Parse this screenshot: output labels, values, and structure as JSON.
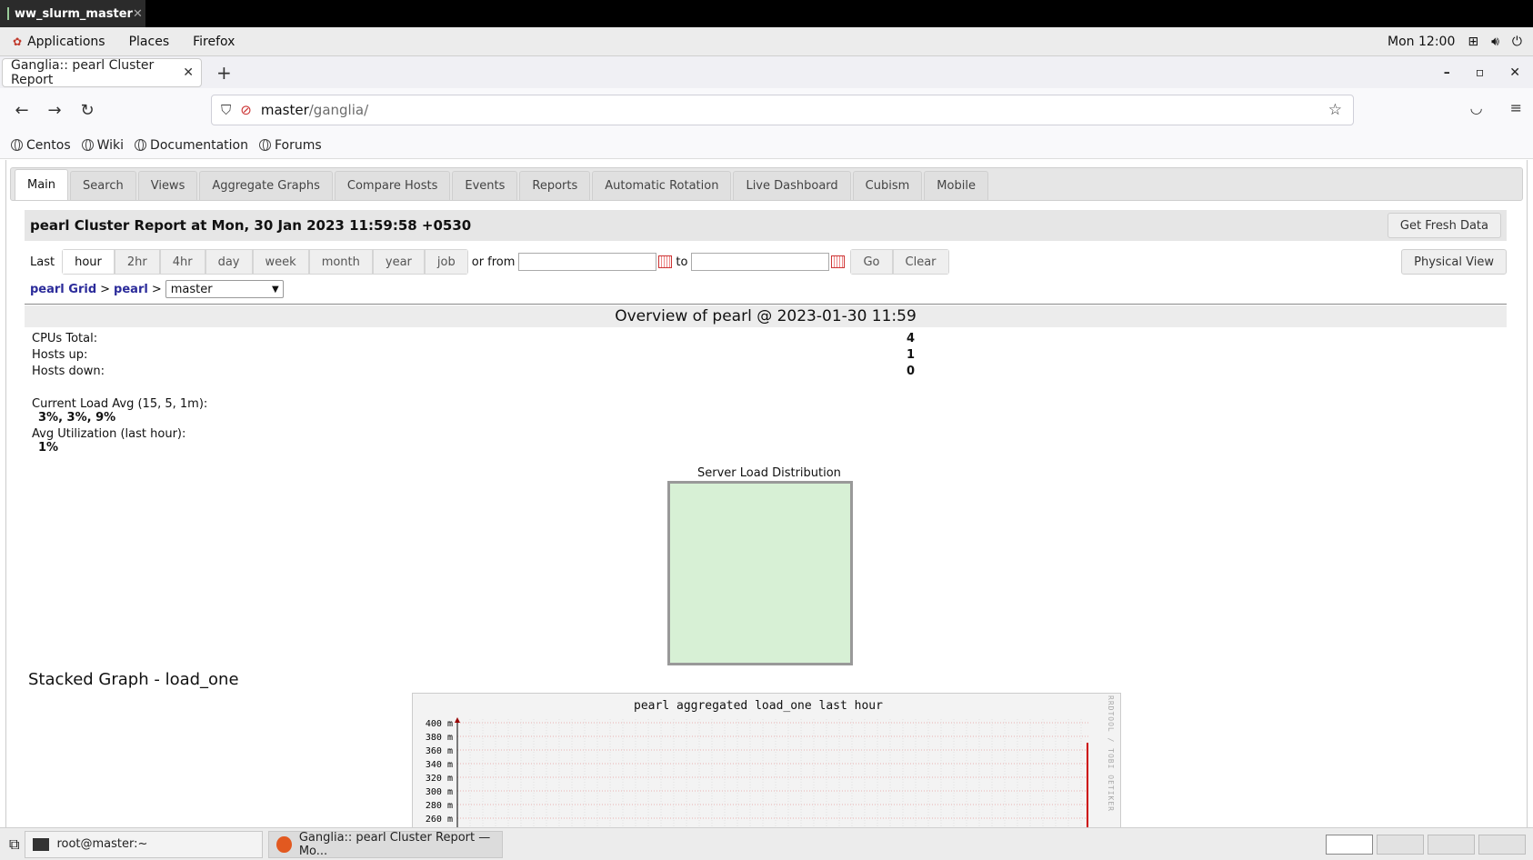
{
  "vnc": {
    "title": "ww_slurm_master"
  },
  "gnome": {
    "menus": [
      "Applications",
      "Places",
      "Firefox"
    ],
    "clock": "Mon 12:00"
  },
  "firefox": {
    "tab_title": "Ganglia:: pearl Cluster Report",
    "url_host": "master",
    "url_path": "/ganglia/",
    "bookmarks": [
      "Centos",
      "Wiki",
      "Documentation",
      "Forums"
    ]
  },
  "ganglia": {
    "tabs": [
      "Main",
      "Search",
      "Views",
      "Aggregate Graphs",
      "Compare Hosts",
      "Events",
      "Reports",
      "Automatic Rotation",
      "Live Dashboard",
      "Cubism",
      "Mobile"
    ],
    "active_tab": "Main",
    "report_title": "pearl Cluster Report at Mon, 30 Jan 2023 11:59:58 +0530",
    "fresh_button": "Get Fresh Data",
    "last_label": "Last",
    "ranges": [
      "hour",
      "2hr",
      "4hr",
      "day",
      "week",
      "month",
      "year",
      "job"
    ],
    "active_range": "hour",
    "or_from_label": "or from",
    "to_label": "to",
    "go_button": "Go",
    "clear_button": "Clear",
    "physical_button": "Physical View",
    "crumb_grid": "pearl Grid",
    "crumb_cluster": "pearl",
    "crumb_sep": ">",
    "host_select": "master",
    "overview_title": "Overview of pearl @ 2023-01-30 11:59",
    "cpus_label": "CPUs Total:",
    "cpus_value": "4",
    "hosts_up_label": "Hosts up:",
    "hosts_up_value": "1",
    "hosts_down_label": "Hosts down:",
    "hosts_down_value": "0",
    "load_label": "Current Load Avg (15, 5, 1m):",
    "load_value": "3%, 3%, 9%",
    "util_label": "Avg Utilization (last hour):",
    "util_value": "1%",
    "sld_title": "Server Load Distribution",
    "stacked_title": "Stacked Graph - load_one",
    "rrd_title": "pearl aggregated load_one last hour",
    "rrd_side": "RRDTOOL / TOBI OETIKER",
    "rrd_yticks": [
      "400 m",
      "380 m",
      "360 m",
      "340 m",
      "320 m",
      "300 m",
      "280 m",
      "260 m"
    ]
  },
  "taskbar": {
    "items": [
      "root@master:~",
      "Ganglia:: pearl Cluster Report — Mo..."
    ]
  }
}
